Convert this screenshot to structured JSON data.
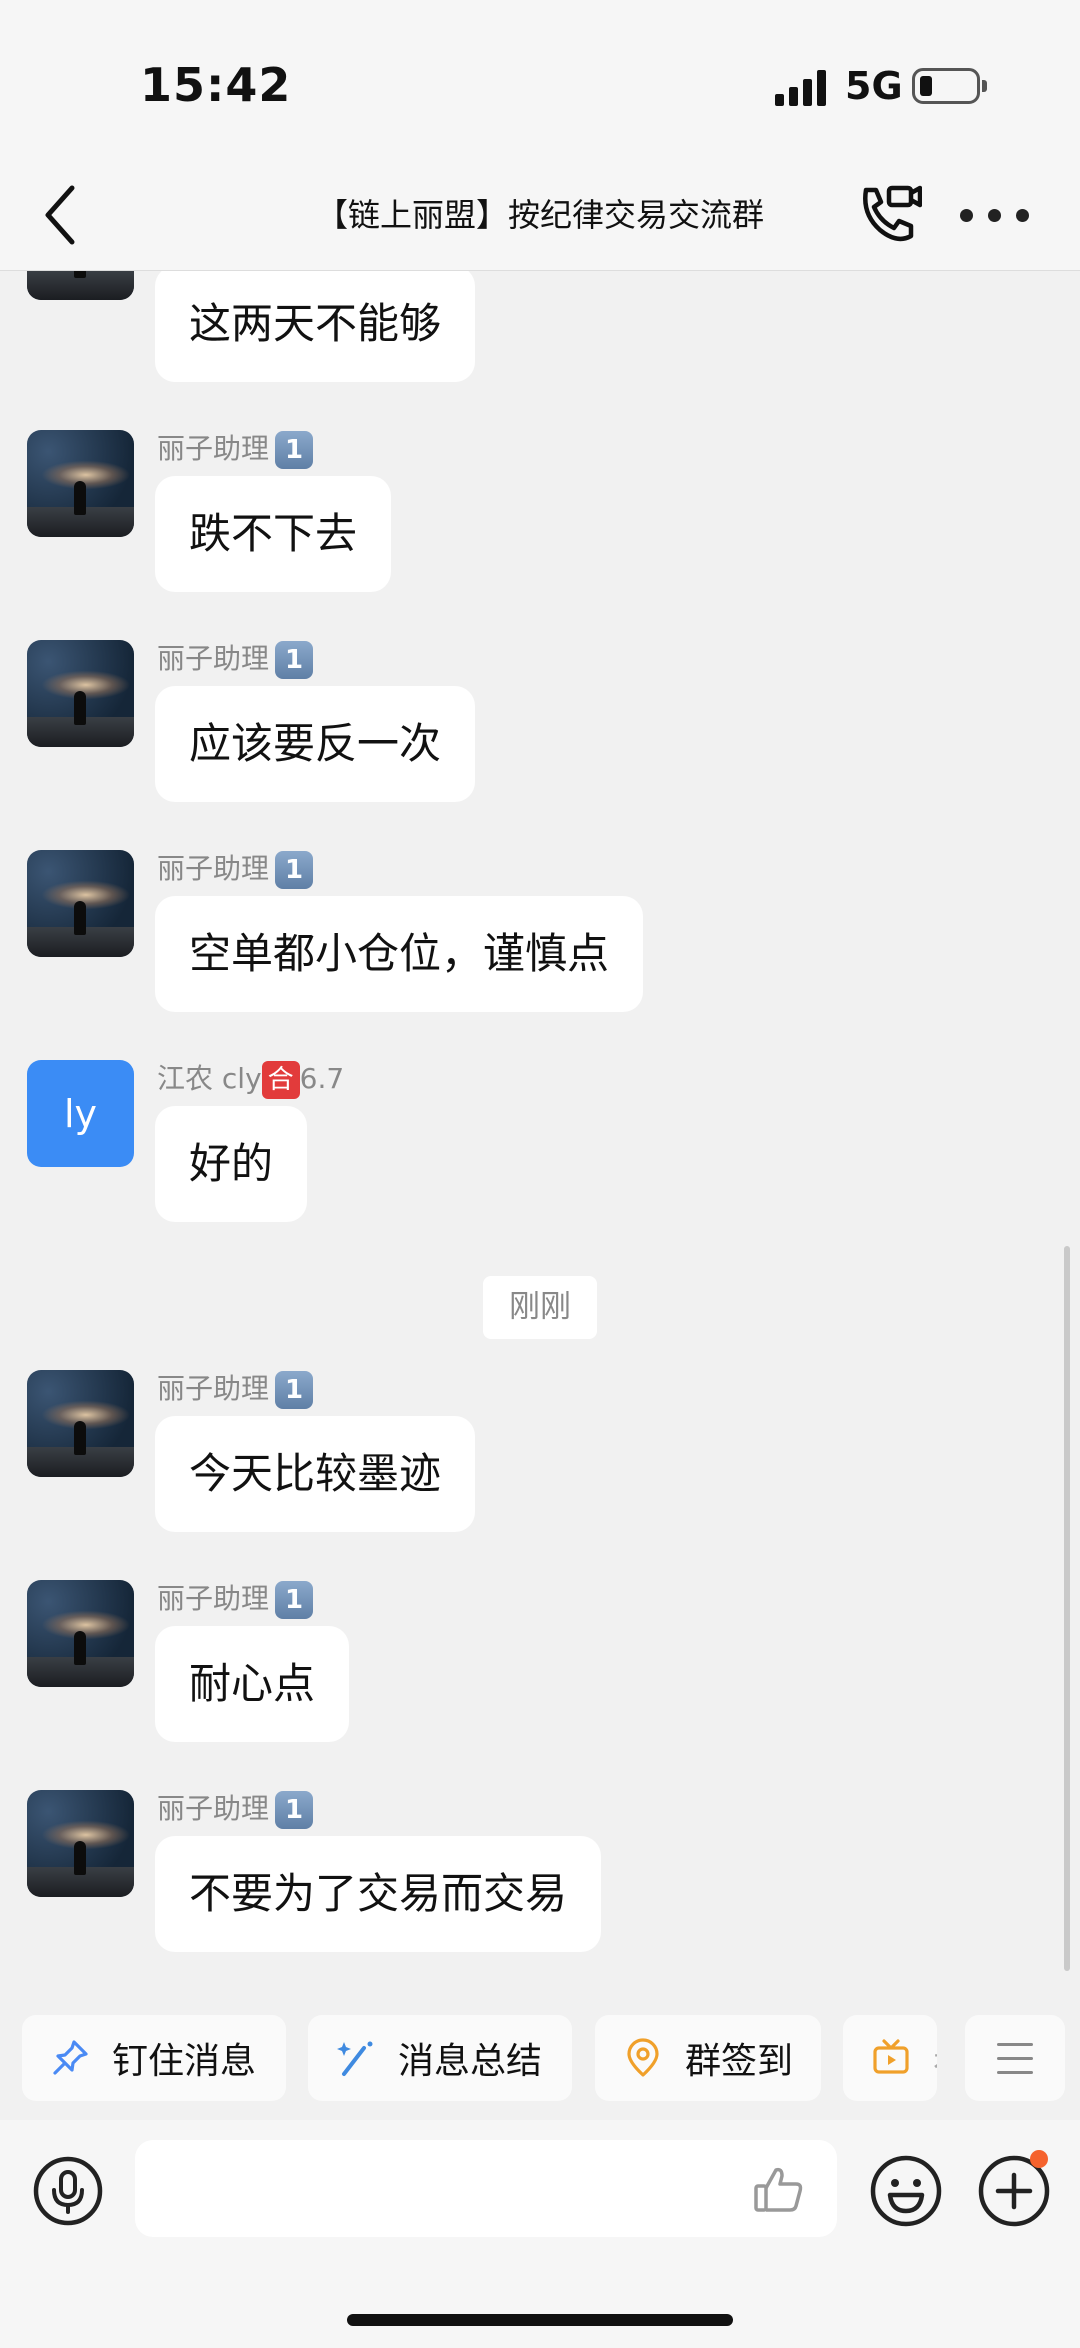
{
  "status_bar": {
    "time": "15:42",
    "network": "5G",
    "battery_fraction": 0.2
  },
  "header": {
    "title": "【链上丽盟】按纪律交易交流群",
    "icons": [
      "back-icon",
      "video-call-icon",
      "more-icon"
    ]
  },
  "messages": [
    {
      "sender": "",
      "badge": "",
      "level": "",
      "avatar": "galaxy",
      "text": "这两天不能够"
    },
    {
      "sender": "丽子助理",
      "badge": "1",
      "level": "",
      "avatar": "galaxy",
      "text": "跌不下去"
    },
    {
      "sender": "丽子助理",
      "badge": "1",
      "level": "",
      "avatar": "galaxy",
      "text": "应该要反一次"
    },
    {
      "sender": "丽子助理",
      "badge": "1",
      "level": "",
      "avatar": "galaxy",
      "text": "空单都小仓位，谨慎点"
    },
    {
      "sender": "江农 cly",
      "badge": "合",
      "level": "6.7",
      "avatar": "ly",
      "text": "好的"
    },
    {
      "sender": "丽子助理",
      "badge": "1",
      "level": "",
      "avatar": "galaxy",
      "text": "今天比较墨迹"
    },
    {
      "sender": "丽子助理",
      "badge": "1",
      "level": "",
      "avatar": "galaxy",
      "text": "耐心点"
    },
    {
      "sender": "丽子助理",
      "badge": "1",
      "level": "",
      "avatar": "galaxy",
      "text": "不要为了交易而交易"
    }
  ],
  "time_separator": "刚刚",
  "quick_actions": [
    {
      "label": "钉住消息",
      "icon": "pin-icon"
    },
    {
      "label": "消息总结",
      "icon": "magic-wand-icon"
    },
    {
      "label": "群签到",
      "icon": "location-checkin-icon"
    },
    {
      "label": "看",
      "icon": "tv-icon"
    }
  ],
  "input": {
    "placeholder": ""
  },
  "colors": {
    "background": "#f1f1f1",
    "bubble": "#ffffff",
    "avatar_blue": "#3b8cf5",
    "notify_dot": "#f5622d",
    "pin_blue": "#4a8af4",
    "wand_blue": "#3f8ae0",
    "orange": "#f0a02a"
  }
}
